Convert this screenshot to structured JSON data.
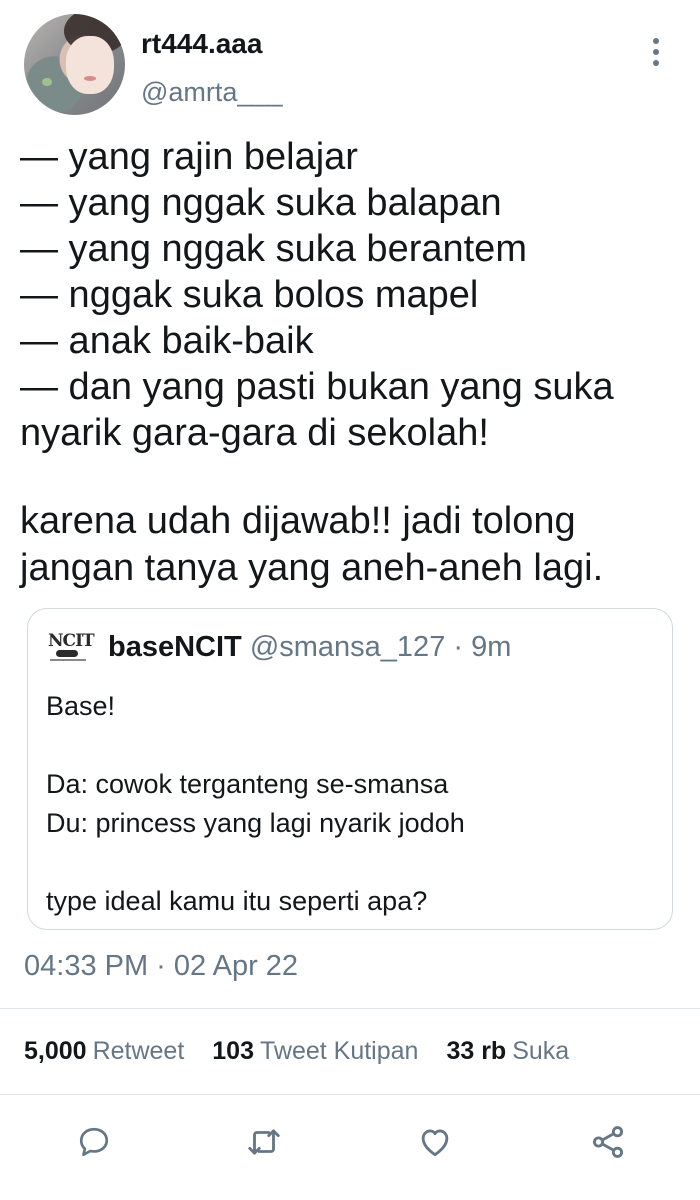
{
  "author": {
    "display_name": "rt444.aaa",
    "handle": "@amrta___"
  },
  "tweet": {
    "lines": [
      "— yang rajin belajar",
      "— yang nggak suka balapan",
      "— yang nggak suka berantem",
      "— nggak suka bolos mapel",
      "— anak baik-baik",
      "— dan yang pasti bukan yang suka",
      "nyarik gara-gara di sekolah!"
    ],
    "paragraph2": [
      "karena udah dijawab!! jadi tolong",
      "jangan tanya yang aneh-aneh lagi."
    ],
    "timestamp": "04:33 PM · 02 Apr 22"
  },
  "quoted": {
    "logo_text": "NCIT",
    "display_name": "baseNCIT",
    "meta": " @smansa_127 · 9m",
    "lines": [
      "Base!",
      "",
      "Da: cowok terganteng se-smansa",
      "Du: princess yang lagi nyarik jodoh",
      "",
      "type ideal kamu itu seperti apa?"
    ]
  },
  "stats": {
    "retweets": "5,000",
    "retweets_label": "Retweet",
    "quotes": "103",
    "quotes_label": "Tweet Kutipan",
    "likes": "33 rb",
    "likes_label": "Suka"
  },
  "icons": {
    "reply": "reply-icon",
    "retweet": "retweet-icon",
    "like": "heart-icon",
    "share": "share-icon",
    "more": "more-vertical-icon"
  },
  "colors": {
    "text": "#14171a",
    "muted": "#657786",
    "border": "#cfd9de"
  }
}
